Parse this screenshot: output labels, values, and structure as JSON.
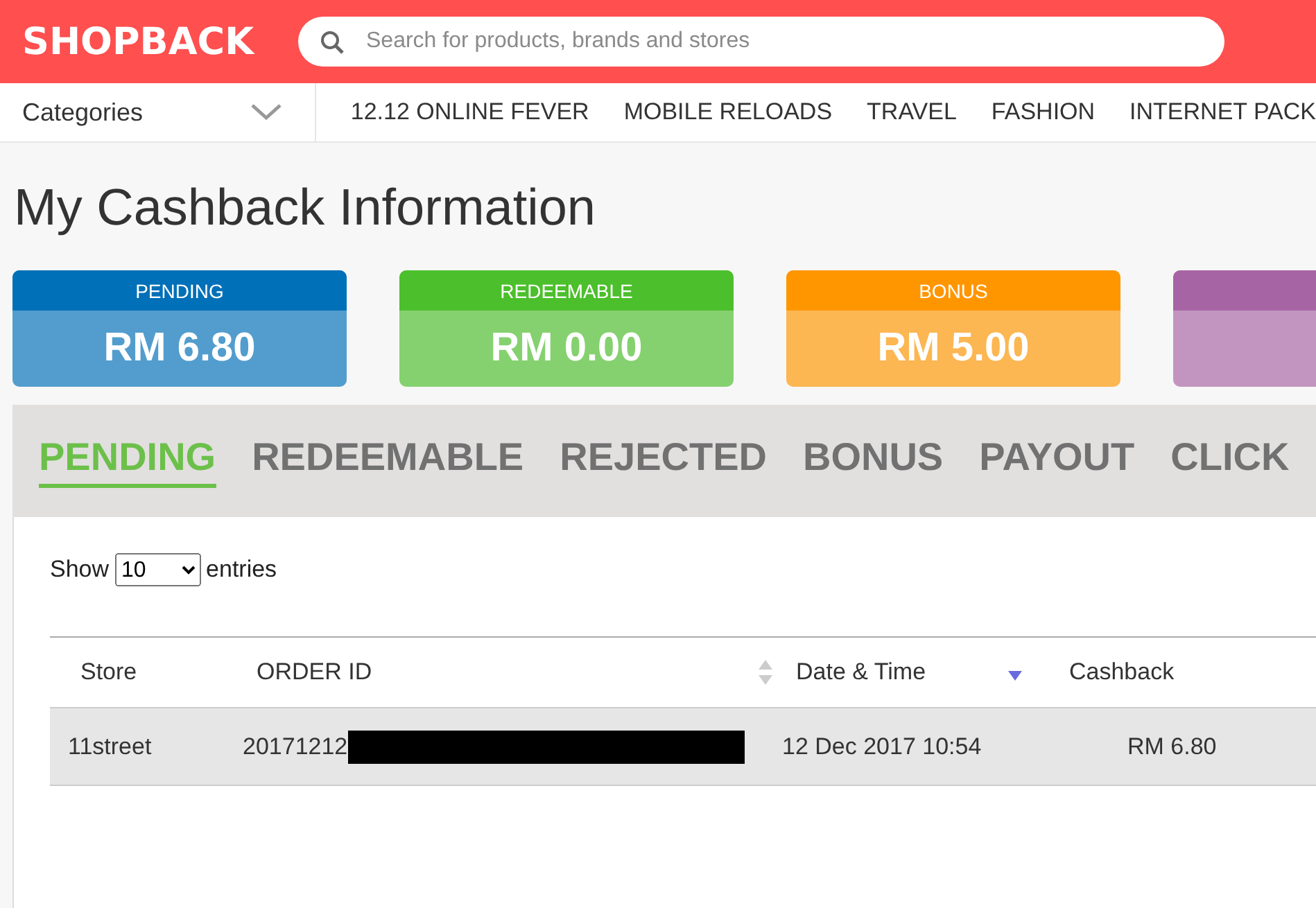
{
  "header": {
    "logo": "SHOPBACK",
    "search": {
      "placeholder": "Search for products, brands and stores"
    }
  },
  "nav": {
    "categories": "Categories",
    "links": [
      "12.12 ONLINE FEVER",
      "MOBILE RELOADS",
      "TRAVEL",
      "FASHION",
      "INTERNET PACK"
    ]
  },
  "page_title": "My Cashback Information",
  "summary_cards": [
    {
      "label": "PENDING",
      "amount": "RM 6.80",
      "color": "#0070b8"
    },
    {
      "label": "REDEEMABLE",
      "amount": "RM 0.00",
      "color": "#4cbf2c"
    },
    {
      "label": "BONUS",
      "amount": "RM 5.00",
      "color": "#ff9600"
    },
    {
      "color": "#a764a4"
    }
  ],
  "tabs": [
    {
      "label": "PENDING",
      "selected": true
    },
    {
      "label": "REDEEMABLE",
      "selected": false
    },
    {
      "label": "REJECTED",
      "selected": false
    },
    {
      "label": "BONUS",
      "selected": false
    },
    {
      "label": "PAYOUT",
      "selected": false
    },
    {
      "label": "CLICK",
      "selected": false
    }
  ],
  "entries": {
    "before": "Show",
    "value": "10",
    "after": "entries"
  },
  "table": {
    "columns": [
      {
        "label": "Store",
        "kind": "plain"
      },
      {
        "label": "ORDER ID",
        "kind": "sortable"
      },
      {
        "label": "Date & Time",
        "kind": "sorted"
      },
      {
        "label": "Cashback",
        "kind": "plain"
      }
    ],
    "rows": [
      {
        "store": "11street",
        "order_id": "20171212",
        "date": "12 Dec 2017 10:54",
        "cashback": "RM 6.80"
      }
    ]
  }
}
